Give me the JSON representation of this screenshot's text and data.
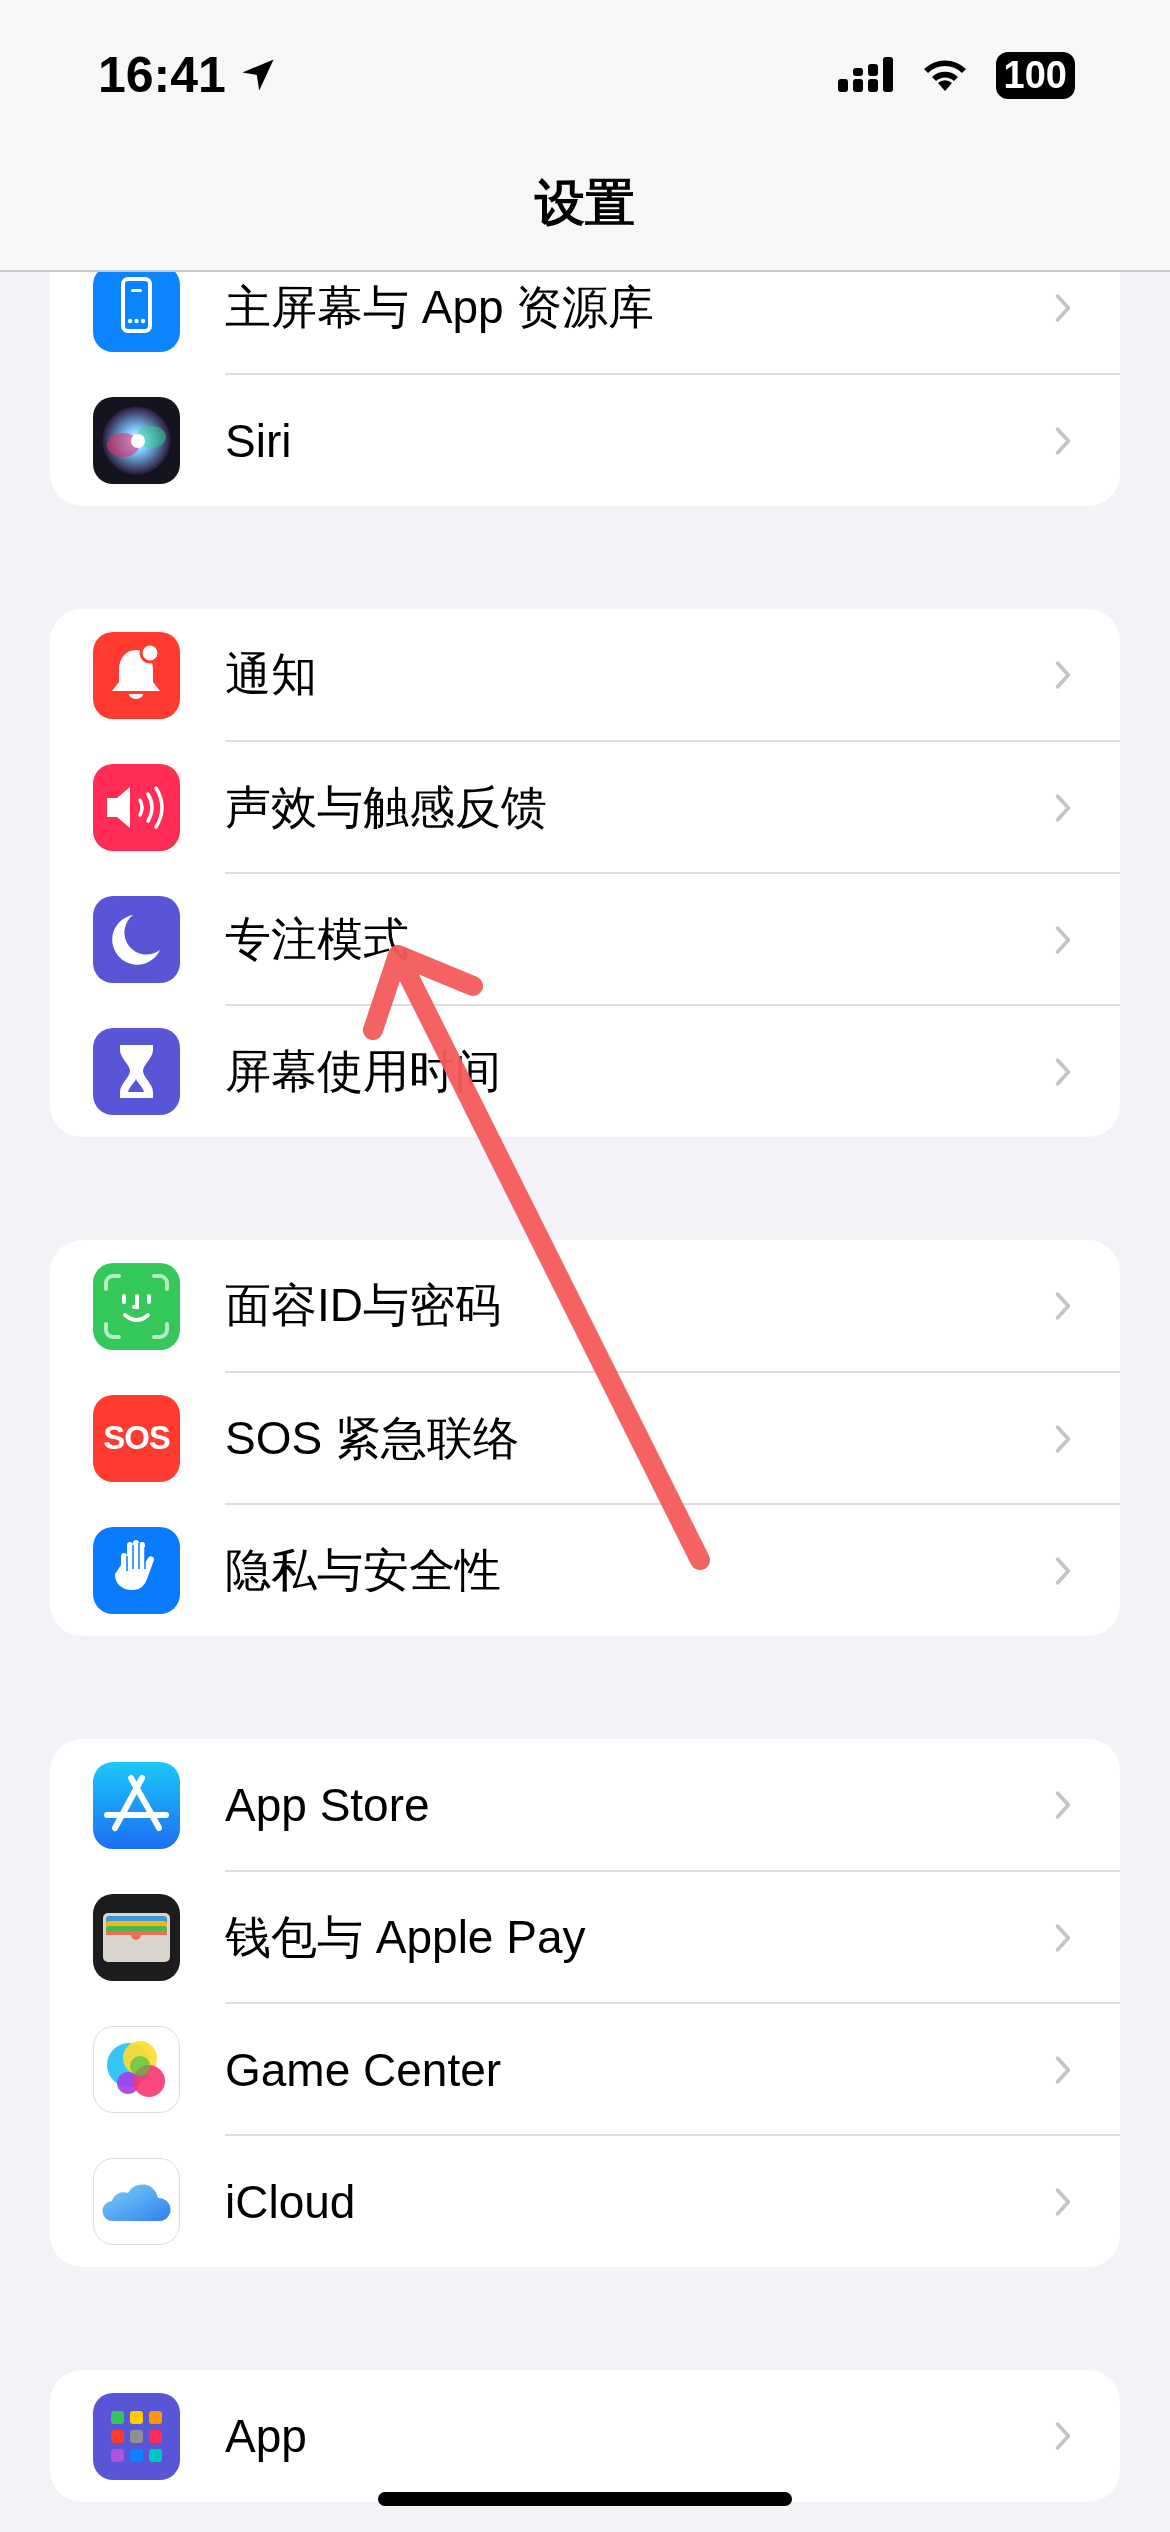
{
  "status_bar": {
    "time": "16:41",
    "battery": "100"
  },
  "nav": {
    "title": "设置"
  },
  "groups": [
    {
      "rows": [
        {
          "label": "主屏幕与 App 资源库"
        },
        {
          "label": "Siri"
        }
      ]
    },
    {
      "rows": [
        {
          "label": "通知"
        },
        {
          "label": "声效与触感反馈"
        },
        {
          "label": "专注模式"
        },
        {
          "label": "屏幕使用时间"
        }
      ]
    },
    {
      "rows": [
        {
          "label": "面容ID与密码"
        },
        {
          "label": "SOS 紧急联络",
          "icon_text": "SOS"
        },
        {
          "label": "隐私与安全性"
        }
      ]
    },
    {
      "rows": [
        {
          "label": "App Store"
        },
        {
          "label": "钱包与 Apple Pay"
        },
        {
          "label": "Game Center"
        },
        {
          "label": "iCloud"
        }
      ]
    },
    {
      "rows": [
        {
          "label": "App"
        }
      ]
    }
  ]
}
